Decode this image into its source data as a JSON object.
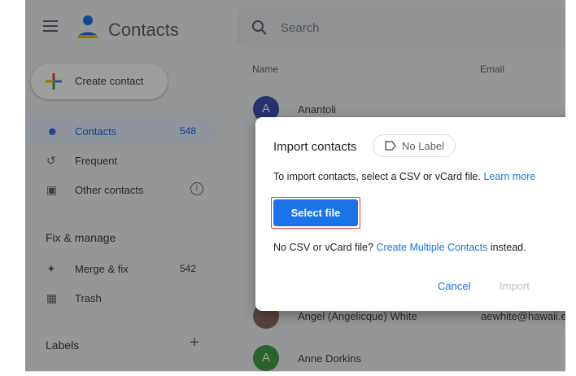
{
  "app": {
    "title": "Contacts"
  },
  "search": {
    "placeholder": "Search"
  },
  "sidebar": {
    "create_label": "Create contact",
    "items": [
      {
        "label": "Contacts",
        "count": "548"
      },
      {
        "label": "Frequent"
      },
      {
        "label": "Other contacts"
      }
    ],
    "fix_header": "Fix & manage",
    "fix_items": [
      {
        "label": "Merge & fix",
        "count": "542"
      },
      {
        "label": "Trash"
      }
    ],
    "labels_header": "Labels",
    "labels_add": "+"
  },
  "table": {
    "columns": [
      "Name",
      "Email"
    ],
    "rows": [
      {
        "initial": "A",
        "name": "Anantoli",
        "email": "",
        "color": "#3f51b5"
      },
      {
        "initial": "",
        "name": "Angel (Angelicque) White",
        "email": "aewhite@hawaii.e",
        "color": "#8d6e63"
      },
      {
        "initial": "A",
        "name": "Anne Dorkins",
        "email": "",
        "color": "#43a047"
      }
    ]
  },
  "dialog": {
    "title": "Import contacts",
    "label_chip": "No Label",
    "text_prefix": "To import contacts, select a CSV or vCard file.",
    "learn_more": "Learn more",
    "select_file": "Select file",
    "text2_prefix": "No CSV or vCard file?",
    "create_multiple": "Create Multiple Contacts",
    "text2_suffix": "instead.",
    "cancel": "Cancel",
    "import": "Import"
  },
  "colors": {
    "accent": "#1a73e8",
    "highlight": "#e53935"
  }
}
